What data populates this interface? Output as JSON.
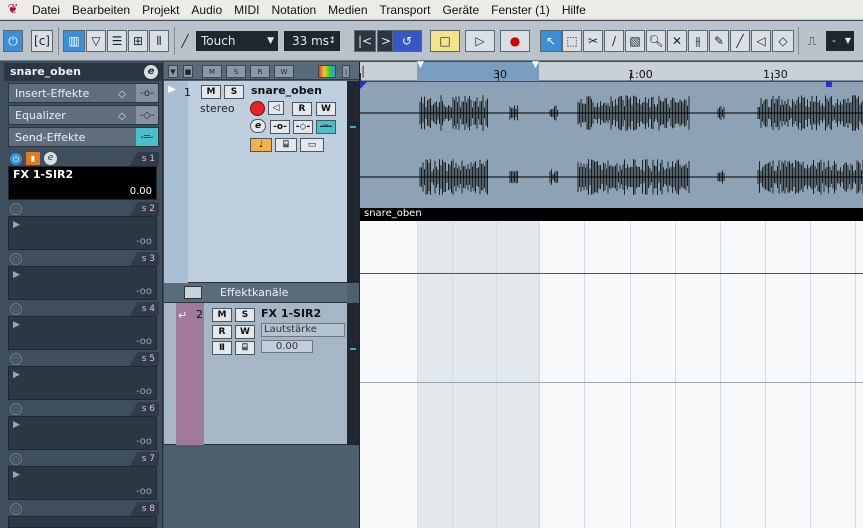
{
  "menu": {
    "items": [
      "Datei",
      "Bearbeiten",
      "Projekt",
      "Audio",
      "MIDI",
      "Notation",
      "Medien",
      "Transport",
      "Geräte",
      "Fenster (1)",
      "Hilfe"
    ]
  },
  "toolbar": {
    "automation_mode": "Touch",
    "nudge_value": "33 ms",
    "quantize_value": "-"
  },
  "inspector": {
    "track_name": "snare_oben",
    "edit_icon": "e",
    "sections": [
      "Insert-Effekte",
      "Equalizer",
      "Send-Effekte"
    ],
    "send1": {
      "label": "s 1",
      "name": "FX 1-SIR2",
      "value": "0.00"
    },
    "empty_sends": [
      {
        "label": "s 2",
        "value": "-oo"
      },
      {
        "label": "s 3",
        "value": "-oo"
      },
      {
        "label": "s 4",
        "value": "-oo"
      },
      {
        "label": "s 5",
        "value": "-oo"
      },
      {
        "label": "s 6",
        "value": "-oo"
      },
      {
        "label": "s 7",
        "value": "-oo"
      },
      {
        "label": "s 8",
        "value": ""
      }
    ]
  },
  "tracks": {
    "track1": {
      "number": "1",
      "name": "snare_oben",
      "channel": "stereo",
      "mute": "M",
      "solo": "S",
      "read": "R",
      "write": "W"
    },
    "folder": {
      "label": "Effektkanäle"
    },
    "track2": {
      "number": "2",
      "name": "FX 1-SIR2",
      "parameter": "Lautstärke",
      "value": "0.00",
      "mute": "M",
      "solo": "S",
      "read": "R",
      "write": "W"
    }
  },
  "arrange": {
    "ruler_labels": [
      "30",
      "1:00",
      "1:30"
    ],
    "clip_name": "snare_oben"
  },
  "colors": {
    "selected_accent": "#3a8fd7",
    "monitor_orange": "#e07a1e",
    "fx_track_color": "#a27a99",
    "cycle_region": "#7b9dc0"
  }
}
